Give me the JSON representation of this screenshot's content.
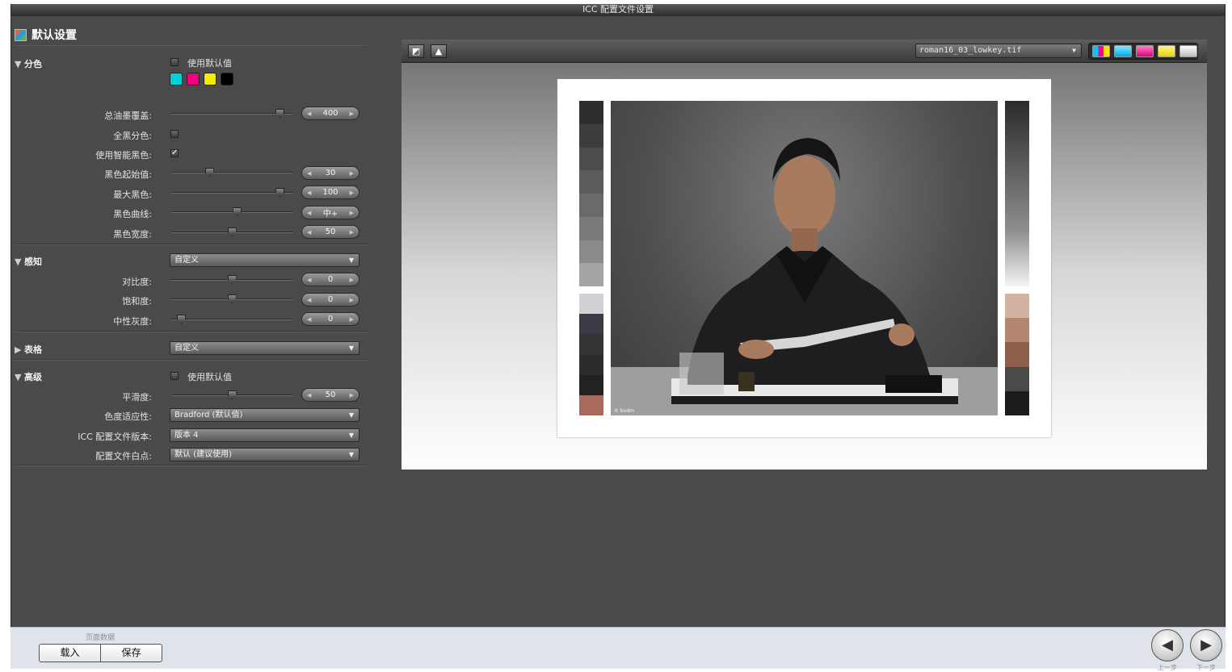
{
  "window": {
    "title": "ICC 配置文件设置"
  },
  "panel": {
    "title": "默认设置"
  },
  "separation": {
    "label": "分色",
    "use_default": "使用默认值",
    "swatch_colors": [
      "#00d3d8",
      "#f0007e",
      "#f2ec00",
      "#000000"
    ],
    "total_ink_label": "总油墨覆盖:",
    "total_ink_value": "400",
    "total_ink_level": 0.93,
    "full_black_label": "全黑分色:",
    "smart_black_label": "使用智能黑色:",
    "smart_black_checked": "✓",
    "black_start_label": "黑色起始值:",
    "black_start_value": "30",
    "black_start_level": 0.3,
    "max_black_label": "最大黑色:",
    "max_black_value": "100",
    "max_black_level": 0.93,
    "black_curve_label": "黑色曲线:",
    "black_curve_value": "中+",
    "black_curve_level": 0.55,
    "black_width_label": "黑色宽度:",
    "black_width_value": "50",
    "black_width_level": 0.5
  },
  "perception": {
    "label": "感知",
    "dropdown": "自定义",
    "contrast_label": "对比度:",
    "contrast_value": "0",
    "contrast_level": 0.5,
    "saturation_label": "饱和度:",
    "saturation_value": "0",
    "saturation_level": 0.5,
    "neutral_gray_label": "中性灰度:",
    "neutral_gray_value": "0",
    "neutral_gray_level": 0.05
  },
  "table": {
    "label": "表格",
    "dropdown": "自定义"
  },
  "advanced": {
    "label": "高级",
    "use_default": "使用默认值",
    "smoothness_label": "平滑度:",
    "smoothness_value": "50",
    "smoothness_level": 0.5,
    "chromatic_label": "色度适应性:",
    "chromatic_value": "Bradford (默认值)",
    "icc_version_label": "ICC 配置文件版本:",
    "icc_version_value": "版本 4",
    "white_point_label": "配置文件白点:",
    "white_point_value": "默认 (建议使用)"
  },
  "preview": {
    "image_select": "roman16_03_lowkey.tif",
    "left_strip": [
      "#2e2e2e",
      "#3d3d3d",
      "#4c4c4c",
      "#5b5b5b",
      "#6a6a6a",
      "#7a7a7a",
      "#8a8a8a",
      "#a4a4a4"
    ],
    "left_strip2": [
      "#d2d0d4",
      "#3a3a44",
      "#333333",
      "#2c2c2c",
      "#222222",
      "#a86a5a"
    ],
    "right_strip2": [
      "#d2b2a0",
      "#b48870",
      "#8e604c",
      "#4a4a4a",
      "#1c1c1c"
    ],
    "photo_caption": "© bvdm"
  },
  "footer": {
    "group_label": "页面数据",
    "load": "载入",
    "save": "保存",
    "prev_label": "上一步",
    "next_label": "下一步"
  }
}
